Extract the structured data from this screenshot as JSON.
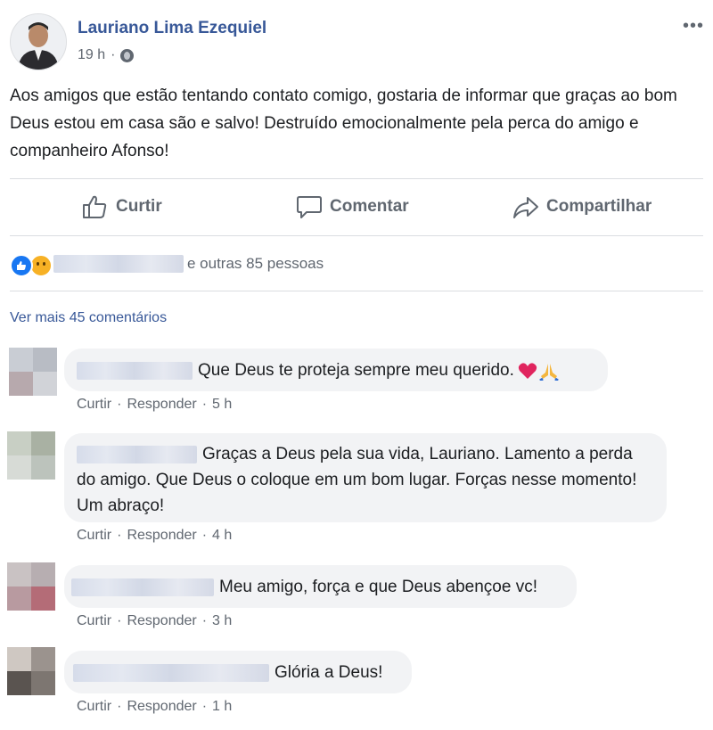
{
  "post": {
    "author": "Lauriano Lima Ezequiel",
    "time": "19 h",
    "more_icon": "more-options-icon",
    "text": "Aos amigos que estão tentando contato comigo, gostaria de informar que graças ao bom Deus estou em casa são e salvo! Destruído emocionalmente pela perca do amigo e companheiro Afonso!"
  },
  "actions": {
    "like": "Curtir",
    "comment": "Comentar",
    "share": "Compartilhar"
  },
  "reactions": {
    "others": "e outras 85 pessoas"
  },
  "comments_link": "Ver mais 45 comentários",
  "comments": [
    {
      "text": "Que Deus te proteja sempre meu querido.",
      "like": "Curtir",
      "reply": "Responder",
      "time": "5 h"
    },
    {
      "text": "Graças a Deus pela sua vida, Lauriano. Lamento a perda do amigo. Que Deus o coloque em um bom lugar. Forças nesse momento! Um abraço!",
      "like": "Curtir",
      "reply": "Responder",
      "time": "4 h"
    },
    {
      "text": "Meu amigo, força e que Deus abençoe vc!",
      "like": "Curtir",
      "reply": "Responder",
      "time": "3 h"
    },
    {
      "text": "Glória a Deus!",
      "like": "Curtir",
      "reply": "Responder",
      "time": "1 h"
    }
  ],
  "colors": {
    "link_blue": "#385898",
    "meta_gray": "#606770",
    "bubble_bg": "#f2f3f5",
    "like_blue": "#1877f2"
  }
}
